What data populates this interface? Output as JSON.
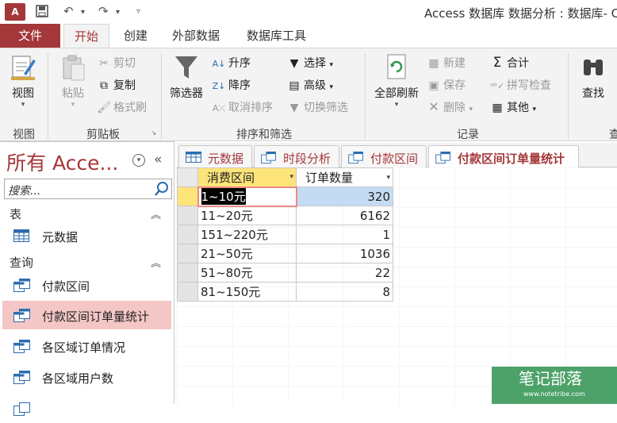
{
  "app": {
    "logo": "A",
    "title": "Access 数据库 数据分析 : 数据库- C"
  },
  "ribbon_tabs": [
    "文件",
    "开始",
    "创建",
    "外部数据",
    "数据库工具"
  ],
  "ribbon": {
    "view": {
      "label": "视图",
      "group": "视图"
    },
    "clipboard": {
      "paste": "粘贴",
      "cut": "剪切",
      "copy": "复制",
      "format_painter": "格式刷",
      "group": "剪贴板"
    },
    "sort_filter": {
      "filter": "筛选器",
      "ascending": "升序",
      "descending": "降序",
      "remove_sort": "取消排序",
      "selection": "选择",
      "advanced": "高级",
      "toggle_filter": "切换筛选",
      "group": "排序和筛选"
    },
    "records": {
      "refresh_all": "全部刷新",
      "new": "新建",
      "save": "保存",
      "delete": "删除",
      "totals": "合计",
      "spelling": "拼写检查",
      "more": "其他",
      "group": "记录"
    },
    "find": {
      "label": "查找",
      "group_partial": "查"
    }
  },
  "nav": {
    "title": "所有 Acce...",
    "search_placeholder": "搜索...",
    "categories": {
      "tables": "表",
      "queries": "查询"
    },
    "tables": [
      "元数据"
    ],
    "queries": [
      "付款区间",
      "付款区间订单量统计",
      "各区域订单情况",
      "各区域用户数"
    ],
    "selected": "付款区间订单量统计"
  },
  "doc_tabs": [
    "元数据",
    "时段分析",
    "付款区间",
    "付款区间订单量统计"
  ],
  "active_tab": "付款区间订单量统计",
  "table": {
    "columns": [
      "消费区间",
      "订单数量"
    ],
    "rows": [
      [
        "1~10元",
        "320"
      ],
      [
        "11~20元",
        "6162"
      ],
      [
        "151~220元",
        "1"
      ],
      [
        "21~50元",
        "1036"
      ],
      [
        "51~80元",
        "22"
      ],
      [
        "81~150元",
        "8"
      ]
    ]
  },
  "watermark": {
    "text": "笔记部落",
    "sub": "www.notetribe.com"
  },
  "colors": {
    "accent": "#a4373a",
    "selection": "#f4c6c6",
    "header_highlight": "#fde47a"
  }
}
